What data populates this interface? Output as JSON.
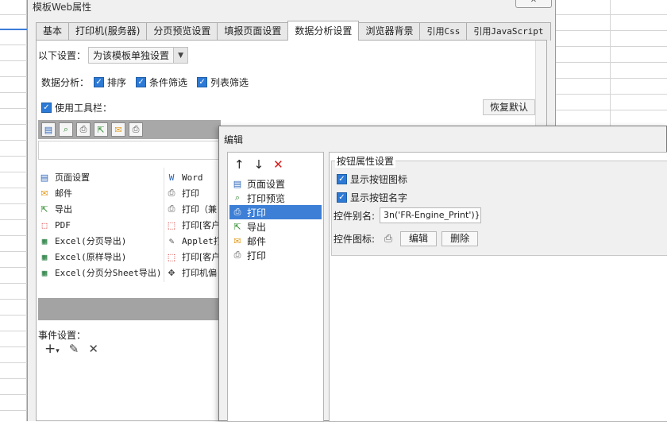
{
  "main_dialog": {
    "title": "模板Web属性",
    "close_glyph": "✕",
    "tabs": [
      {
        "label": "基本",
        "active": false
      },
      {
        "label": "打印机(服务器)",
        "active": false
      },
      {
        "label": "分页预览设置",
        "active": false
      },
      {
        "label": "填报页面设置",
        "active": false
      },
      {
        "label": "数据分析设置",
        "active": true
      },
      {
        "label": "浏览器背景",
        "active": false
      },
      {
        "label": "引用Css",
        "active": false
      },
      {
        "label": "引用JavaScript",
        "active": false
      }
    ],
    "settings_label": "以下设置：",
    "settings_combo_value": "为该模板单独设置",
    "data_analysis_label": "数据分析：",
    "analysis_options": [
      {
        "label": "排序",
        "checked": true
      },
      {
        "label": "条件筛选",
        "checked": true
      },
      {
        "label": "列表筛选",
        "checked": true
      }
    ],
    "use_toolbar_label": "使用工具栏：",
    "use_toolbar_checked": true,
    "restore_button": "恢复默认",
    "toolbar_icons": [
      "page-setup-icon",
      "print-preview-icon",
      "print-icon",
      "export-icon",
      "mail-icon",
      "print-icon"
    ],
    "button_list_left": [
      {
        "icon": "page-setup-icon",
        "label": "页面设置",
        "mono": false
      },
      {
        "icon": "mail-icon",
        "label": "邮件",
        "mono": false
      },
      {
        "icon": "export-icon",
        "label": "导出",
        "mono": false
      },
      {
        "icon": "pdf-icon",
        "label": "PDF",
        "mono": true
      },
      {
        "icon": "excel-icon",
        "label": "Excel(分页导出)",
        "mono": true
      },
      {
        "icon": "excel-icon",
        "label": "Excel(原样导出)",
        "mono": true
      },
      {
        "icon": "excel-icon",
        "label": "Excel(分页分Sheet导出)",
        "mono": true
      }
    ],
    "button_list_right": [
      {
        "icon": "word-icon",
        "label": "Word",
        "mono": true
      },
      {
        "icon": "print-icon",
        "label": "打印",
        "mono": false
      },
      {
        "icon": "print-icon",
        "label": "打印（兼",
        "mono": false
      },
      {
        "icon": "pdf-icon",
        "label": "打印[客户",
        "mono": false
      },
      {
        "icon": "applet-icon",
        "label": "Applet打",
        "mono": true
      },
      {
        "icon": "pdf-icon",
        "label": "打印[客户",
        "mono": false
      },
      {
        "icon": "move-icon",
        "label": "打印机偏",
        "mono": false
      }
    ],
    "event_settings_label": "事件设置："
  },
  "edit_dialog": {
    "title": "编辑",
    "items": [
      {
        "icon": "page-setup-icon",
        "label": "页面设置",
        "selected": false
      },
      {
        "icon": "print-preview-icon",
        "label": "打印预览",
        "selected": false
      },
      {
        "icon": "print-icon",
        "label": "打印",
        "selected": true
      },
      {
        "icon": "export-icon",
        "label": "导出",
        "selected": false
      },
      {
        "icon": "mail-icon",
        "label": "邮件",
        "selected": false
      },
      {
        "icon": "print-icon",
        "label": "打印",
        "selected": false
      }
    ],
    "group_title": "按钮属性设置",
    "show_icon_label": "显示按钮图标",
    "show_icon_checked": true,
    "show_name_label": "显示按钮名字",
    "show_name_checked": true,
    "alias_label": "控件别名:",
    "alias_value": "3n('FR-Engine_Print')}",
    "icon_label": "控件图标:",
    "edit_button": "编辑",
    "delete_button": "删除"
  }
}
